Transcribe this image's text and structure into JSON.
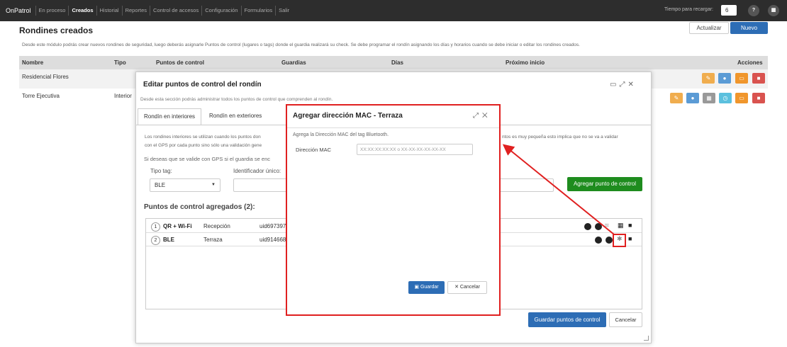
{
  "app": {
    "brand": "OnPatrol",
    "nav": [
      "En proceso",
      "Creados",
      "Historial",
      "Reportes",
      "Control de accesos",
      "Configuración",
      "Formularios",
      "Salir"
    ],
    "active_nav": "Creados",
    "reload_label": "Tiempo para recargar:",
    "reload_value": "6",
    "help_icon": "question-icon",
    "apps_icon": "grid-icon"
  },
  "page": {
    "title": "Rondines creados",
    "update_button": "Actualizar",
    "new_button": "Nuevo",
    "description": "Desde este módulo podrás crear nuevos rondines de seguridad, luego deberás asignarle Puntos de control (lugares o tags) donde el guardia realizará su check. Se debe programar el rondín asignando los días y horarios cuando se debe iniciar o editar los rondines creados."
  },
  "table": {
    "headers": [
      "Nombre",
      "Tipo",
      "Puntos de control",
      "Guardias",
      "Días",
      "Próximo inicio",
      "Acciones"
    ],
    "rows": [
      {
        "name": "Residencial Flores",
        "type": ""
      },
      {
        "name": "Torre Ejecutiva",
        "type": "Interior"
      }
    ]
  },
  "edit_modal": {
    "title": "Editar puntos de control del rondín",
    "description": "Desde esta sección podrás administrar todos los puntos de control que comprenden al rondín.",
    "tabs": [
      "Rondín en interiores",
      "Rondín en exteriores"
    ],
    "info_line1a": "Los rondines interiores se utilizan cuando los puntos don",
    "info_line1b": "ntos es muy pequeña esto implica que no se va a validar",
    "info_line2": "con el GPS por cada punto sino sólo una validación gene",
    "info_line3": "Si deseas que se valide con GPS si el guardia se enc",
    "tag_type_label": "Tipo tag:",
    "tag_type_value": "BLE",
    "unique_id_label": "Identificador único:",
    "add_point_button": "Agregar punto de control",
    "points_title": "Puntos de control agregados (2):",
    "points": [
      {
        "num": "1",
        "type": "QR + Wi-Fi",
        "name": "Recepción",
        "uid": "uid697397"
      },
      {
        "num": "2",
        "type": "BLE",
        "name": "Terraza",
        "uid": "uid914668"
      }
    ],
    "save_button": "Guardar puntos de control",
    "cancel_button": "Cancelar"
  },
  "mac_modal": {
    "title": "Agregar dirección MAC - Terraza",
    "description": "Agrega la Dirección MAC del tag Bluetooth.",
    "mac_label": "Dirección MAC",
    "mac_placeholder": "XX:XX:XX:XX:XX o XX-XX-XX-XX-XX-XX",
    "save_button": "Guardar",
    "cancel_button": "Cancelar"
  },
  "colors": {
    "nav_bg": "#2d2d2d",
    "primary": "#2d6db5",
    "success": "#1e8c1e",
    "annotation": "#e02020"
  }
}
